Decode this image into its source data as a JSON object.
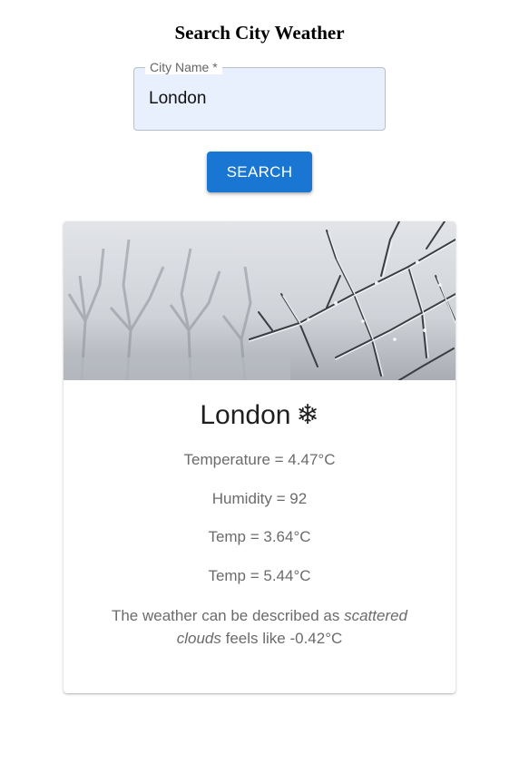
{
  "page": {
    "title": "Search City Weather"
  },
  "search": {
    "label": "City Name *",
    "value": "London",
    "button_label": "SEARCH"
  },
  "card": {
    "image": "frosted-tree-branches-winter",
    "city": "London",
    "weather_icon": "snowflake-icon",
    "temperature": "Temperature = 4.47°C",
    "humidity": "Humidity = 92",
    "temp_min": "Temp = 3.64°C",
    "temp_max": "Temp = 5.44°C",
    "description_prefix": "The weather can be described as",
    "description_condition": "scattered clouds",
    "description_suffix": "feels like -0.42°C"
  },
  "colors": {
    "accent": "#1976d2",
    "input_fill": "#e8f0fe"
  }
}
